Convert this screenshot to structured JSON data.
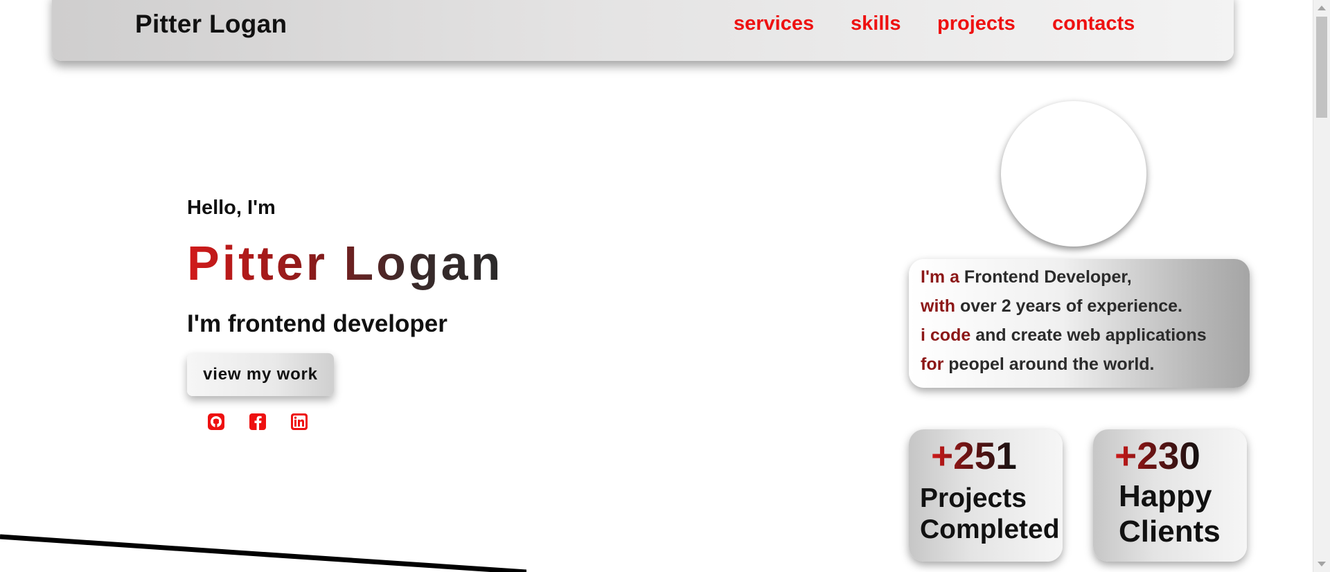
{
  "navbar": {
    "brand": "Pitter Logan",
    "links": [
      "services",
      "skills",
      "projects",
      "contacts"
    ]
  },
  "hero": {
    "greeting": "Hello, I'm",
    "name": "Pitter Logan",
    "role": "I'm frontend developer",
    "cta_label": "view my work"
  },
  "socials": [
    {
      "icon": "github-icon"
    },
    {
      "icon": "facebook-icon"
    },
    {
      "icon": "linkedin-icon"
    }
  ],
  "about": {
    "lines": [
      {
        "accent": "I'm a",
        "text": " Frontend Developer,"
      },
      {
        "accent": "with",
        "text": " over 2 years of experience."
      },
      {
        "accent": "i code",
        "text": " and create web applications"
      },
      {
        "accent": "for",
        "text": " peopel around the world."
      }
    ]
  },
  "stats": [
    {
      "number": "+251",
      "label_line1": "Projects",
      "label_line2": "Completed"
    },
    {
      "number": "+230",
      "label_line1": "Happy",
      "label_line2": "Clients"
    }
  ],
  "colors": {
    "accent_red": "#ee1111",
    "dark_red": "#8c1717"
  }
}
